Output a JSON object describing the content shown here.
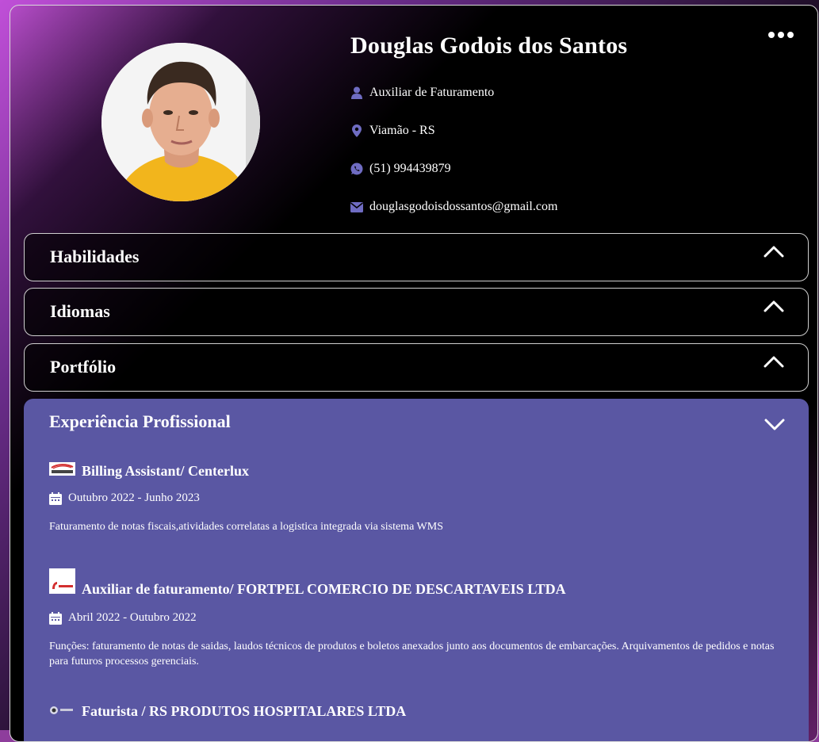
{
  "profile": {
    "name": "Douglas Godois dos Santos",
    "role": "Auxiliar de Faturamento",
    "location": "Viamão - RS",
    "phone": "(51) 994439879",
    "email": "douglasgodoisdossantos@gmail.com"
  },
  "colors": {
    "accent": "#5a57a3",
    "icon": "#6f6cc2",
    "card_bg": "#000000",
    "page_glow": "#c04fd8"
  },
  "sections": {
    "skills": "Habilidades",
    "languages": "Idiomas",
    "portfolio": "Portfólio",
    "experience": "Experiência Profissional"
  },
  "experience": [
    {
      "logo_text": "centerlux",
      "title": "Billing Assistant/ Centerlux",
      "period": "Outubro 2022 - Junho 2023",
      "description": "Faturamento de notas fiscais,atividades correlatas a logistica integrada via sistema WMS"
    },
    {
      "logo_text": "FORTPEL",
      "title": "Auxiliar de faturamento/ FORTPEL COMERCIO DE DESCARTAVEIS LTDA",
      "period": "Abril 2022 - Outubro 2022",
      "description": "Funções: faturamento de notas de saidas, laudos técnicos de produtos e boletos anexados junto aos documentos de embarcações. Arquivamentos de pedidos e notas para futuros processos gerenciais."
    },
    {
      "logo_text": "",
      "title": "Faturista / RS PRODUTOS HOSPITALARES LTDA",
      "period": "",
      "description": ""
    }
  ],
  "icons": {
    "more": "more-horizontal-icon",
    "user": "user-icon",
    "location": "map-pin-icon",
    "whatsapp": "whatsapp-icon",
    "email": "envelope-icon",
    "calendar": "calendar-icon",
    "chevron_up": "chevron-up-icon",
    "chevron_down": "chevron-down-icon"
  }
}
